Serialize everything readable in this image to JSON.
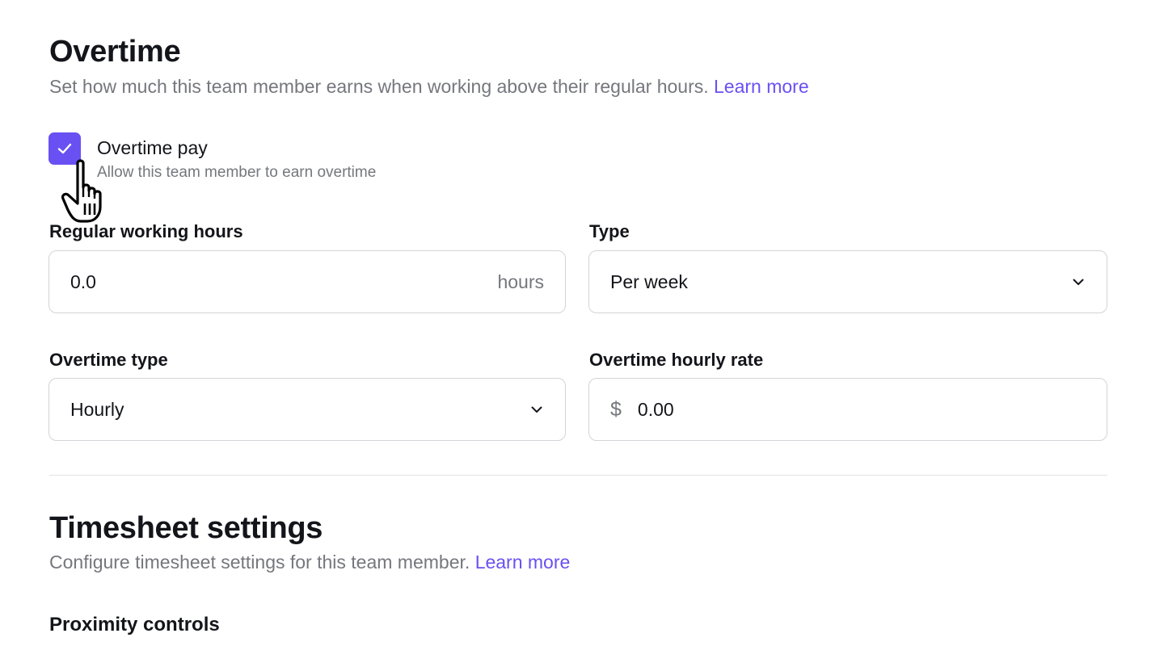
{
  "overtime": {
    "title": "Overtime",
    "description": "Set how much this team member earns when working above their regular hours.",
    "learn_more": "Learn more",
    "checkbox": {
      "label": "Overtime pay",
      "hint": "Allow this team member to earn overtime",
      "checked": true
    },
    "regular_hours": {
      "label": "Regular working hours",
      "value": "0.0",
      "suffix": "hours"
    },
    "type": {
      "label": "Type",
      "value": "Per week"
    },
    "overtime_type": {
      "label": "Overtime type",
      "value": "Hourly"
    },
    "hourly_rate": {
      "label": "Overtime hourly rate",
      "prefix": "$",
      "value": "0.00"
    }
  },
  "timesheet": {
    "title": "Timesheet settings",
    "description": "Configure timesheet settings for this team member.",
    "learn_more": "Learn more",
    "proximity_title": "Proximity controls"
  },
  "icons": {
    "checkbox": "check-icon",
    "select": "chevron-down-icon",
    "cursor": "hand-pointer-icon"
  },
  "colors": {
    "accent": "#6950f3",
    "text": "#14151a",
    "muted": "#75777d",
    "border": "#d3d4d8"
  }
}
